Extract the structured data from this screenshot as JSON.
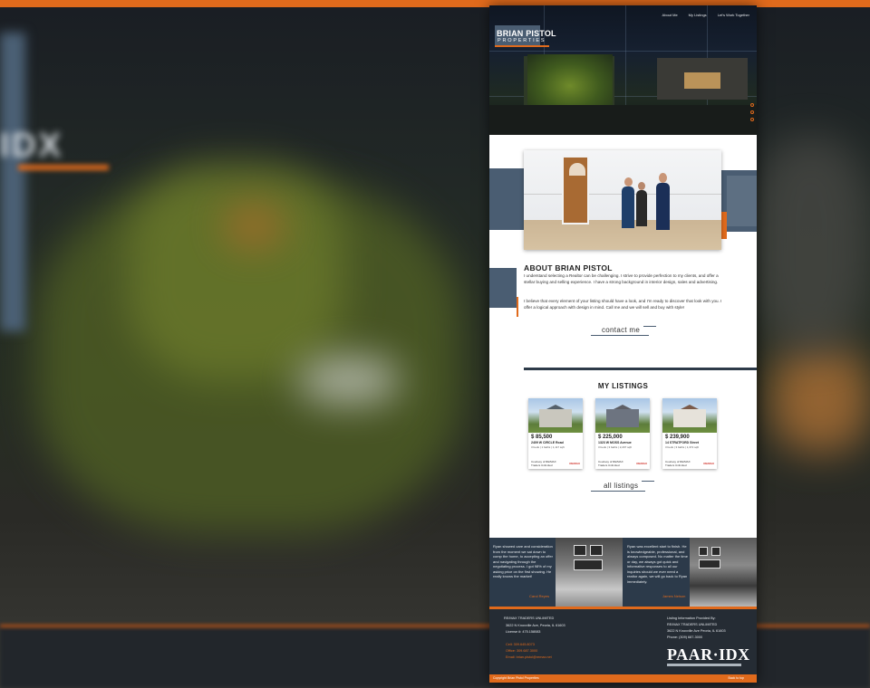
{
  "nav": {
    "about": "About Me",
    "listings": "My Listings",
    "work": "Let's Work Together"
  },
  "brand": {
    "name": "BRIAN PISTOL",
    "sub": "PROPERTIES"
  },
  "about": {
    "title": "ABOUT BRIAN PISTOL",
    "p1": "I understand selecting a Realtor can be challenging. I strive to provide perfection to my clients, and offer a stellar buying and selling experience. I have a strong background in interior design, sales and advertising.",
    "p2": "I believe that every element of your listing should have a look, and I'm ready to discover that look with you. I offer a logical approach with design in mind. Call me and we will sell and buy with style!",
    "contact_label": "contact me"
  },
  "listings": {
    "title": "MY LISTINGS",
    "cards": [
      {
        "price": "$ 85,500",
        "address": "2409 W CIRCLE Road",
        "meta": "3 beds | 1 baths | 1,117 sqft",
        "courtesy": "Courtesy of RE/MAX Traders Unlimited",
        "brand": "RE/MAX"
      },
      {
        "price": "$ 225,000",
        "address": "1323 W MOSS Avenue",
        "meta": "3 beds | 3 baths | 2,297 sqft",
        "courtesy": "Courtesy of RE/MAX Traders Unlimited",
        "brand": "RE/MAX"
      },
      {
        "price": "$ 239,900",
        "address": "14 STRATFORD Street",
        "meta": "3 beds | 3 baths | 1,372 sqft",
        "courtesy": "Courtesy of RE/MAX Traders Unlimited",
        "brand": "RE/MAX"
      }
    ],
    "all_label": "all listings"
  },
  "testimonials": [
    {
      "quote": "Ryan showed care and consideration from the moment we sat down to comp the home, to accepting an offer and navigating through the negotiating process. I got 98% of my asking price on the first showing. He really knows the market!",
      "author": "Carol Reyes"
    },
    {
      "quote": "Ryan was excellent start to finish. He is knowledgeable, professional, and always composed. No matter the time or day, we always got quick and informative responses to all our inquiries should we ever need a realtor again, we will go back to Ryan immediately.",
      "author": "James Nelson"
    }
  ],
  "footer": {
    "company": "RE/MAX TRADERS UNLIMITED",
    "address": "3622 N Knoxville Ave, Peoria, IL 61603",
    "license": "License #: 475.158083",
    "cell": "Cell: 309.645.8073",
    "office": "Office: 309.687.3000",
    "email": "Email: brian.pistol@remax.net",
    "provided_by": "Listing Information Provided By:",
    "provider": "RE/MAX TRADERS UNLIMITED",
    "provider_address": "3622 N Knoxville Ave Peoria, IL 61603",
    "provider_phone": "Phone: (309) 687-3000",
    "paar": "PAAR·IDX",
    "copyright": "Copyright Brian Pistol Properties",
    "top": "Back to top"
  },
  "colors": {
    "accent": "#e06a1c",
    "slate": "#4a5d72",
    "navy": "#2c3a4a",
    "footer": "#252c34"
  }
}
